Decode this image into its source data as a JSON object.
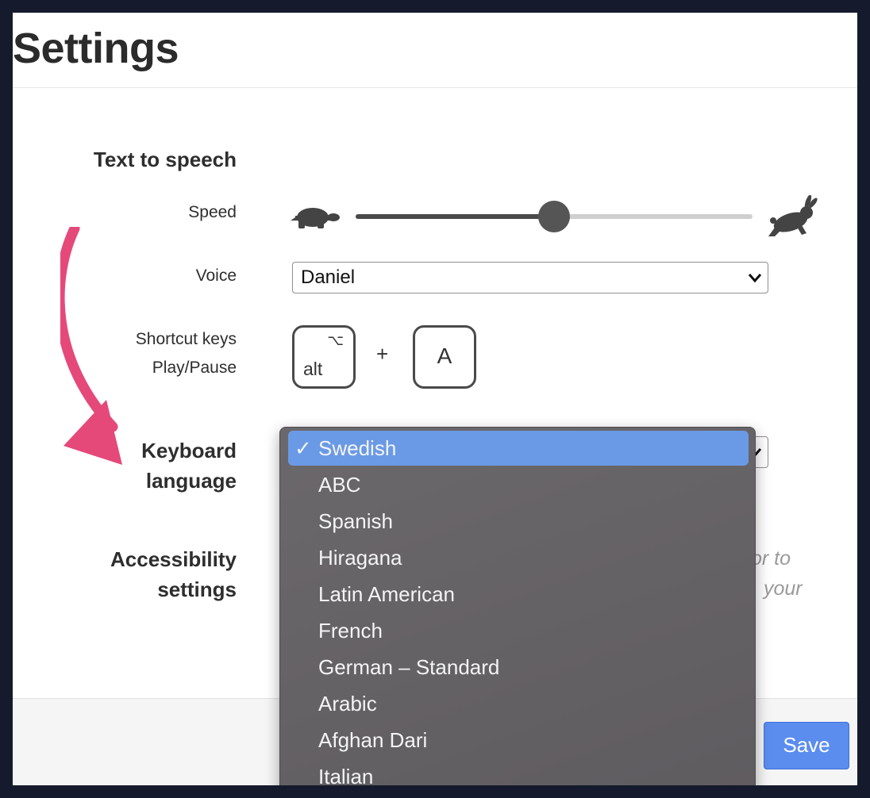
{
  "page": {
    "title": "Settings"
  },
  "tts": {
    "heading": "Text to speech",
    "speed": {
      "label": "Speed",
      "value": 0.5,
      "slow_icon": "turtle-icon",
      "fast_icon": "rabbit-icon"
    },
    "voice": {
      "label": "Voice",
      "selected": "Daniel"
    },
    "shortcut": {
      "label_line1": "Shortcut keys",
      "label_line2": "Play/Pause",
      "modifier": "alt",
      "modifier_glyph": "⌥",
      "plus": "+",
      "key": "A"
    }
  },
  "keyboard": {
    "label_line1": "Keyboard",
    "label_line2": "language",
    "check_glyph": "✓",
    "options": [
      "Swedish",
      "ABC",
      "Spanish",
      "Hiragana",
      "Latin American",
      "French",
      "German – Standard",
      "Arabic",
      "Afghan Dari",
      "Italian"
    ],
    "selected_index": 0
  },
  "accessibility": {
    "label_line1": "Accessibility",
    "label_line2": "settings",
    "hint_line1_visible": "or to",
    "hint_line2_visible": "your"
  },
  "footer": {
    "save_label": "Save"
  },
  "colors": {
    "accent": "#5b8def",
    "annotation_arrow": "#e5497a",
    "menu_selected": "#6a9ae6"
  }
}
